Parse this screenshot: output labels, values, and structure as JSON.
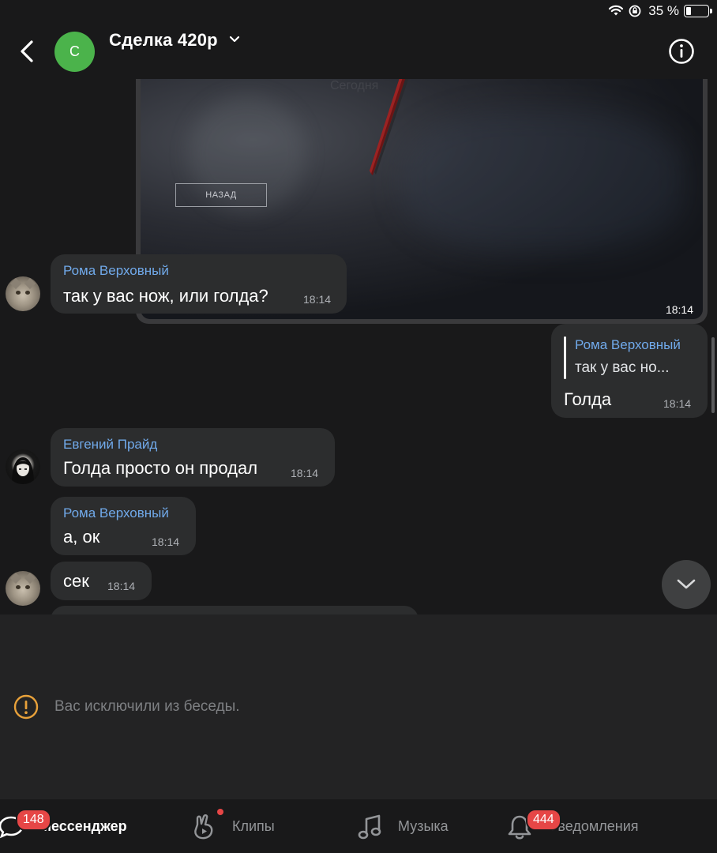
{
  "status_bar": {
    "battery_text": "35 %"
  },
  "header": {
    "title": "Сделка 420р",
    "avatar_letter": "С"
  },
  "photo_message": {
    "button_label": "НАЗАД",
    "time": "18:14"
  },
  "messages": [
    {
      "sender": "Рома Верховный",
      "text": "так у вас нож, или голда?",
      "time": "18:14"
    },
    {
      "reply_to_name": "Рома Верховный",
      "reply_to_text": "так у вас но...",
      "text": "Голда",
      "time": "18:14"
    },
    {
      "sender": "Евгений Прайд",
      "text": "Голда просто он продал",
      "time": "18:14"
    },
    {
      "sender": "Рома Верховный",
      "text": "а, ок",
      "time": "18:14"
    },
    {
      "text": "сек",
      "time": "18:14"
    }
  ],
  "input_area": {
    "notice": "Вас исключили из беседы."
  },
  "tabbar": {
    "tabs": [
      {
        "label": "Мессенджер",
        "badge": "148",
        "active": true
      },
      {
        "label": "Клипы",
        "has_dot": true
      },
      {
        "label": "Музыка"
      },
      {
        "label": "Уведомления",
        "badge": "444"
      }
    ]
  },
  "colors": {
    "accent_name": "#71aaeb",
    "badge": "#e64646",
    "avatar_green": "#4bb34b",
    "bubble": "#2c2d2e"
  }
}
